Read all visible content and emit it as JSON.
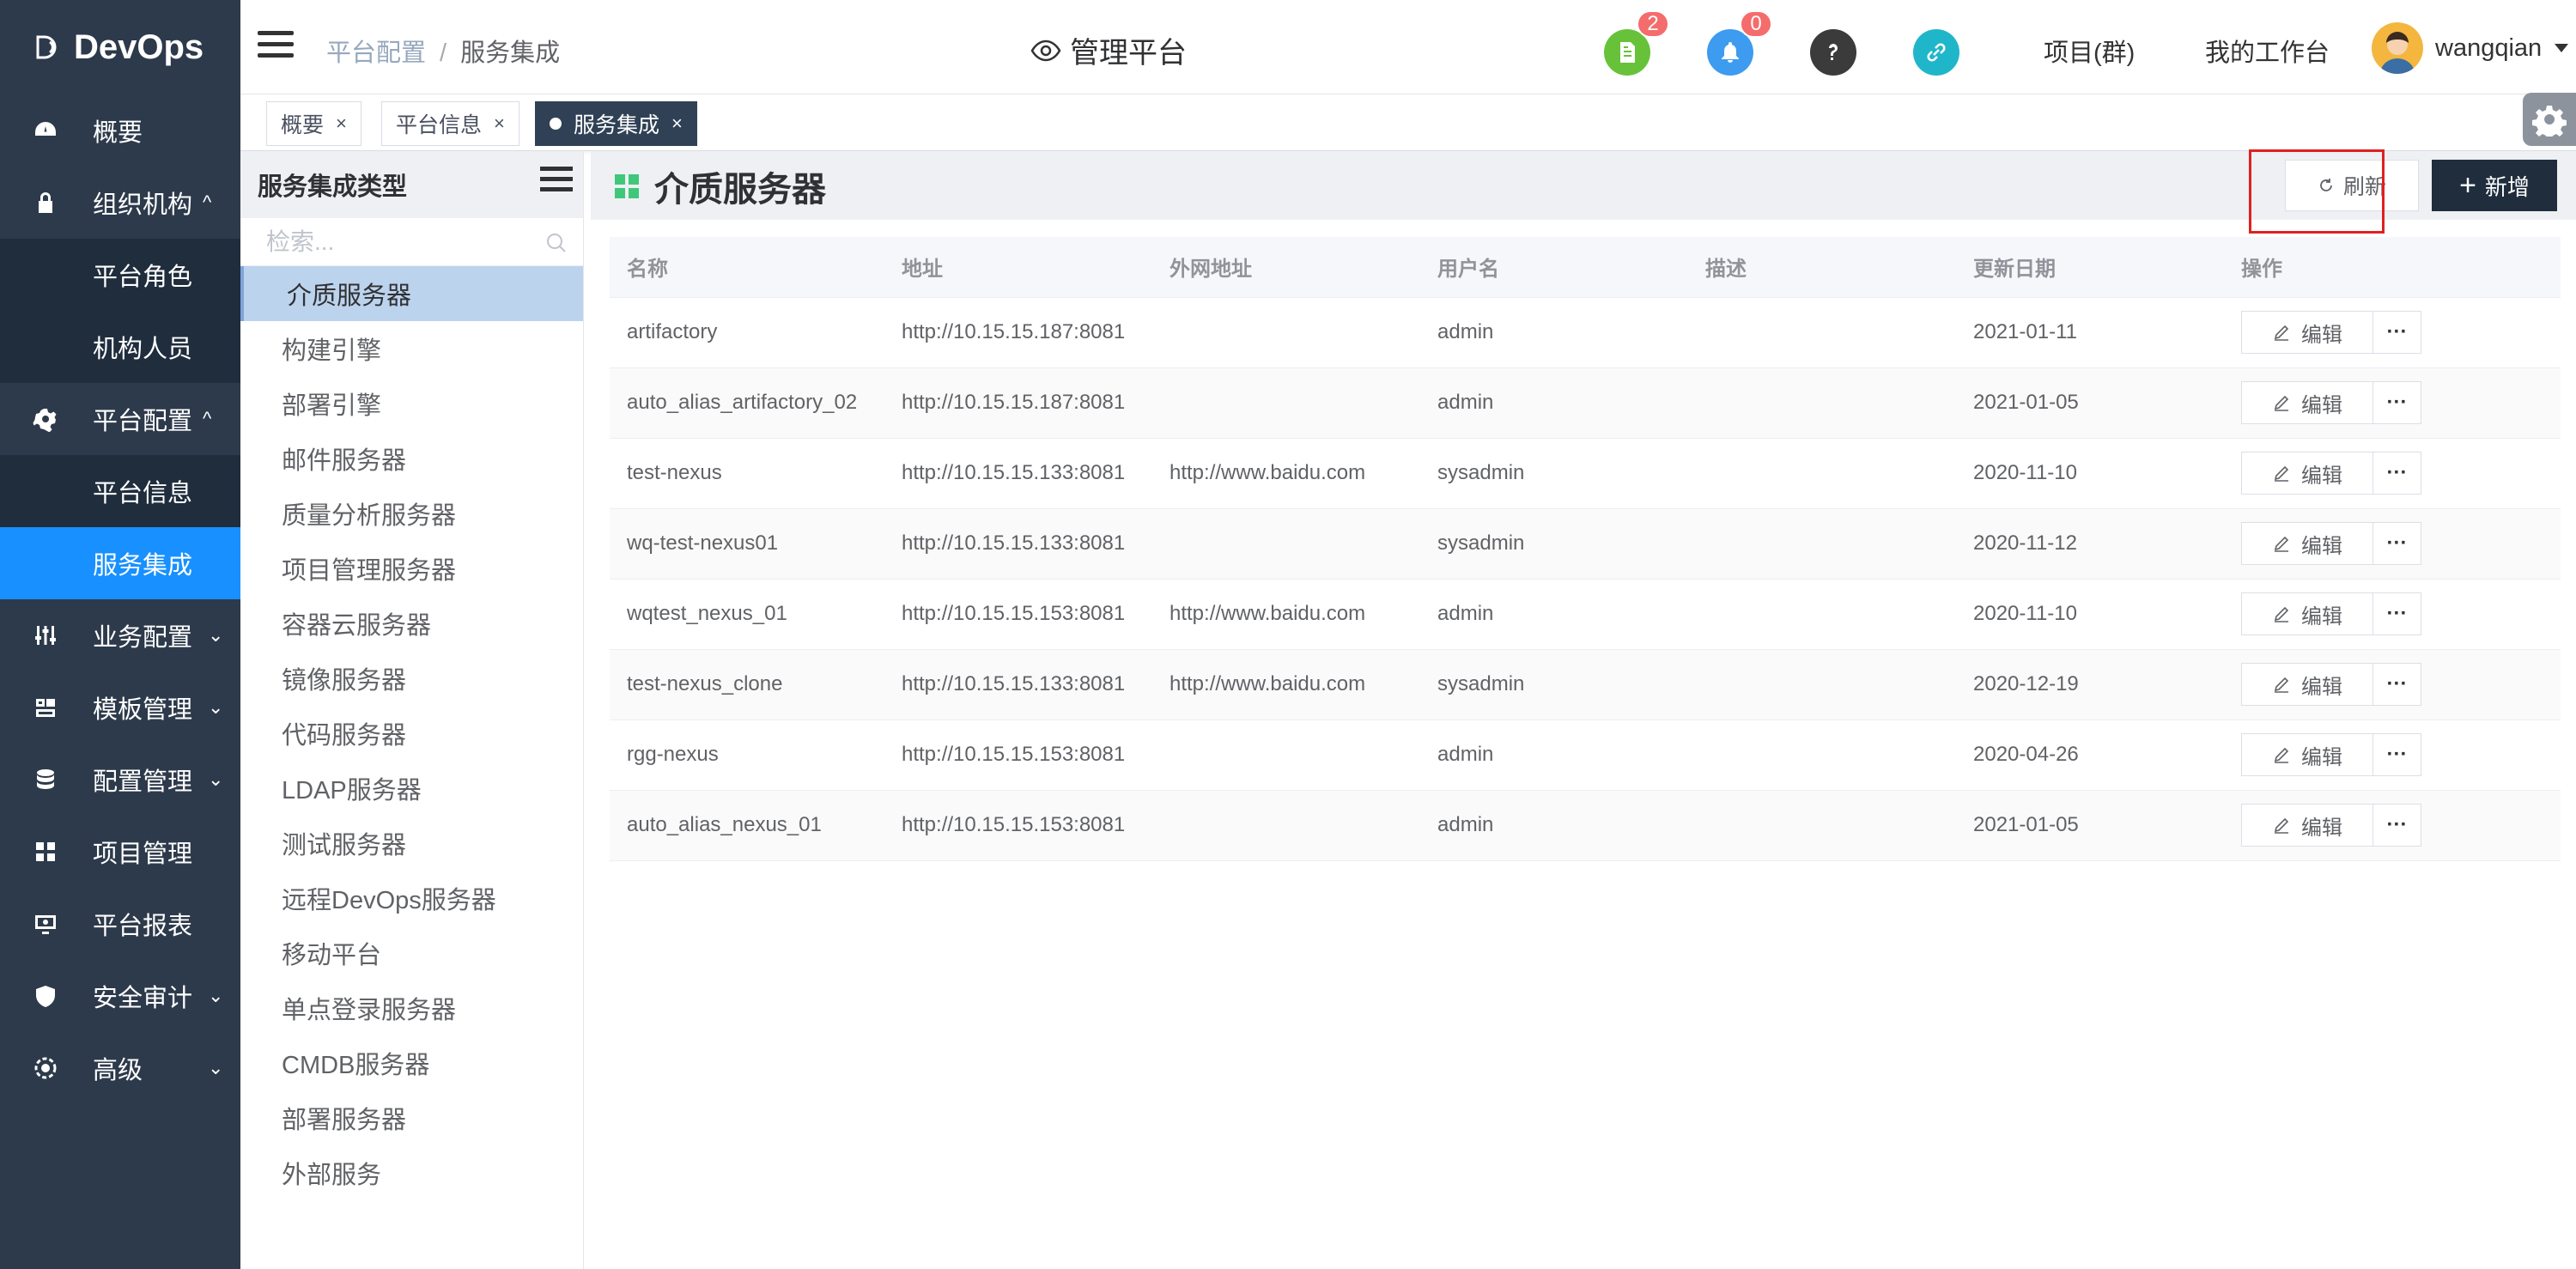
{
  "app": {
    "logo_text": "DevOps"
  },
  "sidebar": {
    "items": [
      {
        "label": "概要",
        "icon": "dashboard-icon"
      },
      {
        "label": "组织机构",
        "icon": "lock-icon",
        "expanded": true
      },
      {
        "label": "平台角色"
      },
      {
        "label": "机构人员"
      },
      {
        "label": "平台配置",
        "icon": "gear-icon",
        "expanded": true
      },
      {
        "label": "平台信息"
      },
      {
        "label": "服务集成",
        "active": true
      },
      {
        "label": "业务配置",
        "icon": "sliders-icon"
      },
      {
        "label": "模板管理",
        "icon": "template-icon"
      },
      {
        "label": "配置管理",
        "icon": "database-icon"
      },
      {
        "label": "项目管理",
        "icon": "apps-icon"
      },
      {
        "label": "平台报表",
        "icon": "monitor-icon"
      },
      {
        "label": "安全审计",
        "icon": "shield-icon"
      },
      {
        "label": "高级",
        "icon": "advanced-icon"
      }
    ]
  },
  "header": {
    "breadcrumb": [
      "平台配置",
      "服务集成"
    ],
    "platform_title": "管理平台",
    "badges": {
      "notes": "2",
      "bell": "0"
    },
    "links": {
      "projects": "项目(群)",
      "workbench": "我的工作台"
    },
    "username": "wangqian"
  },
  "tags": [
    {
      "label": "概要",
      "close": "×"
    },
    {
      "label": "平台信息",
      "close": "×"
    },
    {
      "label": "服务集成",
      "close": "×",
      "active": true
    }
  ],
  "category": {
    "title": "服务集成类型",
    "search_placeholder": "检索...",
    "items": [
      "介质服务器",
      "构建引擎",
      "部署引擎",
      "邮件服务器",
      "质量分析服务器",
      "项目管理服务器",
      "容器云服务器",
      "镜像服务器",
      "代码服务器",
      "LDAP服务器",
      "测试服务器",
      "远程DevOps服务器",
      "移动平台",
      "单点登录服务器",
      "CMDB服务器",
      "部署服务器",
      "外部服务"
    ],
    "active_index": 0
  },
  "main": {
    "title": "介质服务器",
    "refresh_label": "刷新",
    "add_label": "新增",
    "columns": [
      "名称",
      "地址",
      "外网地址",
      "用户名",
      "描述",
      "更新日期",
      "操作"
    ],
    "edit_label": "编辑",
    "more_label": "···",
    "rows": [
      [
        "artifactory",
        "http://10.15.15.187:8081",
        "",
        "admin",
        "",
        "2021-01-11"
      ],
      [
        "auto_alias_artifactory_02",
        "http://10.15.15.187:8081",
        "",
        "admin",
        "",
        "2021-01-05"
      ],
      [
        "test-nexus",
        "http://10.15.15.133:8081",
        "http://www.baidu.com",
        "sysadmin",
        "",
        "2020-11-10"
      ],
      [
        "wq-test-nexus01",
        "http://10.15.15.133:8081",
        "",
        "sysadmin",
        "",
        "2020-11-12"
      ],
      [
        "wqtest_nexus_01",
        "http://10.15.15.153:8081",
        "http://www.baidu.com",
        "admin",
        "",
        "2020-11-10"
      ],
      [
        "test-nexus_clone",
        "http://10.15.15.133:8081",
        "http://www.baidu.com",
        "sysadmin",
        "",
        "2020-12-19"
      ],
      [
        "rgg-nexus",
        "http://10.15.15.153:8081",
        "",
        "admin",
        "",
        "2020-04-26"
      ],
      [
        "auto_alias_nexus_01",
        "http://10.15.15.153:8081",
        "",
        "admin",
        "",
        "2021-01-05"
      ]
    ]
  },
  "colors": {
    "sidebar": "#2d3a4b",
    "active": "#1890ff",
    "highlight": "#e02020",
    "add_button": "#1f2d3d"
  }
}
